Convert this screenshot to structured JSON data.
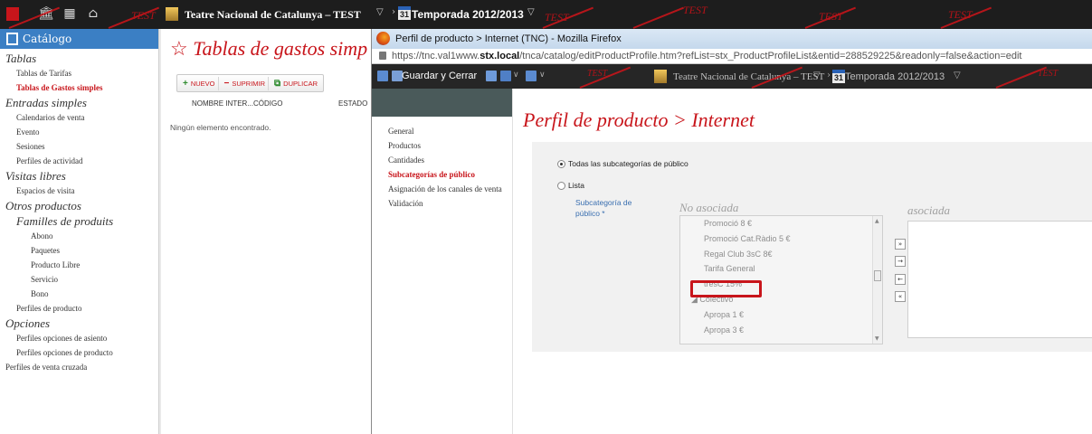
{
  "topbar": {
    "organization": "Teatre Nacional de Catalunya – TEST",
    "season": "Temporada 2012/2013",
    "calendar_day": "31",
    "watermark": "TEST",
    "colors": {
      "bg": "#1d1d1d",
      "accent": "#c8151b"
    }
  },
  "sidebar": {
    "header": "Catálogo",
    "sections": [
      {
        "title": "Tablas",
        "items": [
          "Tablas de Tarifas",
          "Tablas de Gastos simples"
        ],
        "active": "Tablas de Gastos simples"
      },
      {
        "title": "Entradas simples",
        "items": [
          "Calendarios de venta",
          "Evento",
          "Sesiones",
          "Perfiles de actividad"
        ]
      },
      {
        "title": "Visitas libres",
        "items": [
          "Espacios de visita"
        ]
      },
      {
        "title": "Otros productos",
        "subsection": "Familles de produits",
        "subitems": [
          "Abono",
          "Paquetes",
          "Producto Libre",
          "Servicio",
          "Bono"
        ],
        "items": [
          "Perfiles de producto"
        ]
      },
      {
        "title": "Opciones",
        "items": [
          "Perfiles opciones de asiento",
          "Perfiles opciones de producto"
        ]
      }
    ],
    "root_item": "Perfiles de venta cruzada"
  },
  "middle": {
    "title": "Tablas de gastos simp",
    "toolbar": {
      "new": "NUEVO",
      "delete": "SUPRIMIR",
      "duplicate": "DUPLICAR"
    },
    "columns": [
      "NOMBRE INTER...",
      "CÓDIGO",
      "ESTADO"
    ],
    "empty": "Ningún elemento encontrado."
  },
  "popup": {
    "window_title": "Perfil de producto > Internet (TNC) - Mozilla Firefox",
    "url_prefix": "https://tnc.val1www.",
    "url_domain": "stx.local",
    "url_suffix": "/tnca/catalog/editProductProfile.htm?refList=stx_ProductProfileList&entid=288529225&readonly=false&action=edit",
    "save_label": "Guardar y Cerrar",
    "organization": "Teatre Nacional de Catalunya – TEST",
    "season": "Temporada 2012/2013",
    "calendar_day": "31",
    "nav": [
      "General",
      "Productos",
      "Cantidades",
      "Subcategorías de público",
      "Asignación de los canales de venta",
      "Validación"
    ],
    "nav_active": "Subcategorías de público",
    "page_title": "Perfil de producto > Internet",
    "radio_all": "Todas las subcategorías de público",
    "radio_list": "Lista",
    "field_label_1": "Subcategoría de",
    "field_label_2": "público *",
    "col_not_assoc": "No asociada",
    "col_assoc": "asociada",
    "list_items": [
      {
        "label": "Promoció 8 €",
        "group": false
      },
      {
        "label": "Promoció Cat.Ràdio 5 €",
        "group": false
      },
      {
        "label": "Regal Club 3sC 8€",
        "group": false
      },
      {
        "label": "Tarifa General",
        "group": false
      },
      {
        "label": "tresC 15%",
        "group": false
      },
      {
        "label": "◢ Colectivo",
        "group": true
      },
      {
        "label": "Apropa 1 €",
        "group": false
      },
      {
        "label": "Apropa 3 €",
        "group": false
      }
    ],
    "highlighted_item": "tresC 15%"
  }
}
